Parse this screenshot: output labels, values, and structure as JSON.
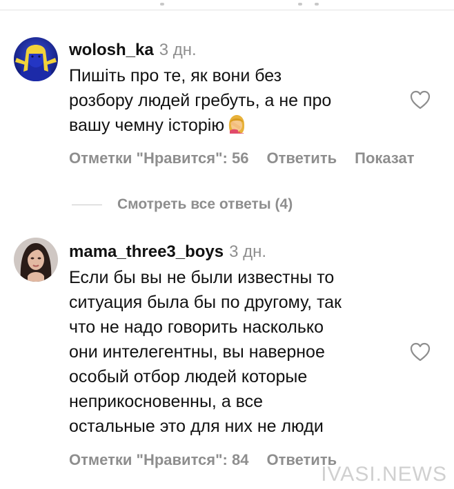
{
  "comments": [
    {
      "username": "wolosh_ka",
      "time": "3 дн.",
      "lines": [
        "Пишіть про те, як вони без",
        "розбору людей гребуть, а не про",
        "вашу чемну історію"
      ],
      "emoji_icon": "facepalm-emoji",
      "likes_label": "Отметки \"Нравится\": 56",
      "reply_label": "Ответить",
      "show_label": "Показат"
    },
    {
      "username": "mama_three3_boys",
      "time": "3 дн.",
      "lines": [
        "Если бы вы не были известны то",
        "ситуация была бы по другому, так",
        "что не надо говорить насколько",
        "они интелегентны, вы наверное",
        "особый отбор людей которые",
        "неприкосновенны, а все",
        "остальные это для них не люди"
      ],
      "likes_label": "Отметки \"Нравится\": 84",
      "reply_label": "Ответить"
    }
  ],
  "replies_link": "Смотреть все ответы (4)",
  "watermark": "IVASI.NEWS",
  "icons": {
    "like": "heart-outline-icon",
    "avatar1": "avatar-blue-yellow",
    "avatar2": "avatar-photo"
  },
  "colors": {
    "text": "#111111",
    "muted": "#8e8e8e",
    "divider": "#c7c7c7"
  }
}
